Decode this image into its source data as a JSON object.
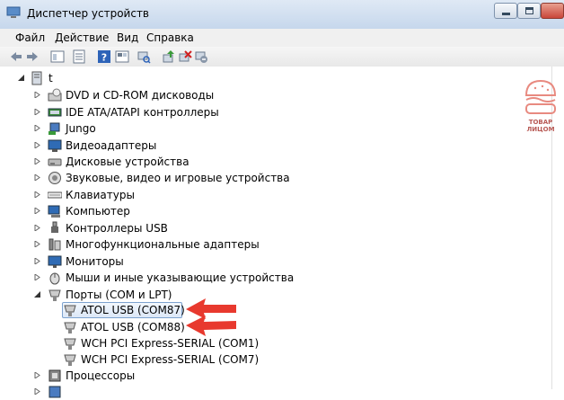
{
  "window": {
    "title": "Диспетчер устройств"
  },
  "menu": [
    "Файл",
    "Действие",
    "Вид",
    "Справка"
  ],
  "tree": {
    "root": "t",
    "categories": [
      "DVD и CD-ROM дисководы",
      "IDE ATA/ATAPI контроллеры",
      "Jungo",
      "Видеоадаптеры",
      "Дисковые устройства",
      "Звуковые, видео и игровые устройства",
      "Клавиатуры",
      "Компьютер",
      "Контроллеры USB",
      "Многофункциональные адаптеры",
      "Мониторы",
      "Мыши и иные указывающие устройства",
      "Порты (COM и LPT)"
    ],
    "ports": [
      "ATOL USB (COM87)",
      "ATOL USB (COM88)",
      "WCH PCI Express-SERIAL (COM1)",
      "WCH PCI Express-SERIAL (COM7)"
    ],
    "after": [
      "Процессоры"
    ]
  },
  "watermark": {
    "line1": "ТОВАР",
    "line2": "ЛИЦОМ"
  },
  "colors": {
    "arrow": "#e8392e",
    "selection": "#dce8f7"
  }
}
